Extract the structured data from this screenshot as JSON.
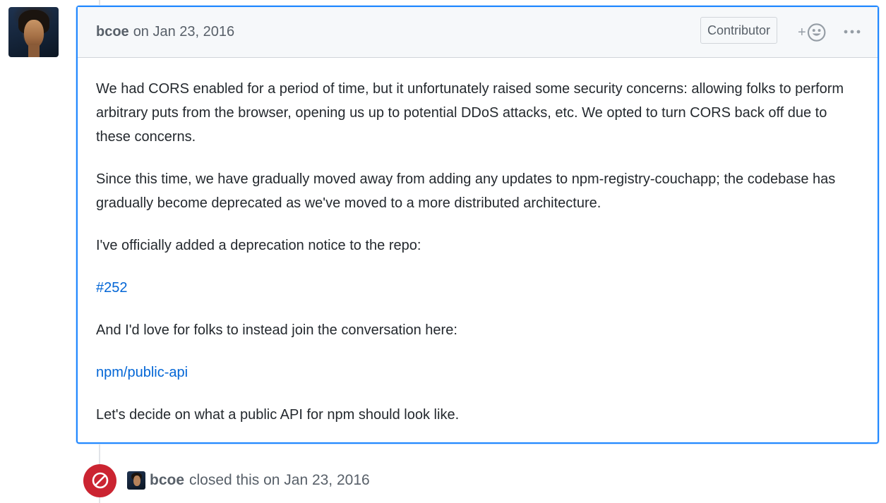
{
  "comment": {
    "author": "bcoe",
    "date": "on Jan 23, 2016",
    "badge": "Contributor",
    "reaction_plus": "+",
    "paragraphs": [
      "We had CORS enabled for a period of time, but it unfortunately raised some security concerns: allowing folks to perform arbitrary puts from the browser, opening us up to potential DDoS attacks, etc. We opted to turn CORS back off due to these concerns.",
      "Since this time, we have gradually moved away from adding any updates to npm-registry-couchapp; the codebase has gradually become deprecated as we've moved to a more distributed architecture.",
      "I've officially added a deprecation notice to the repo:",
      "#252",
      "And I'd love for folks to instead join the conversation here:",
      "npm/public-api",
      "Let's decide on what a public API for npm should look like."
    ]
  },
  "event": {
    "author": "bcoe",
    "text": "closed this on Jan 23, 2016",
    "status_color": "#cb2431"
  },
  "icons": {
    "avatar": "user-avatar",
    "reaction": "smiley-icon",
    "more": "kebab-horizontal-icon",
    "closed": "circle-slash-icon"
  },
  "colors": {
    "link": "#0366d6",
    "focus_border": "#2188ff",
    "muted_text": "#586069"
  }
}
